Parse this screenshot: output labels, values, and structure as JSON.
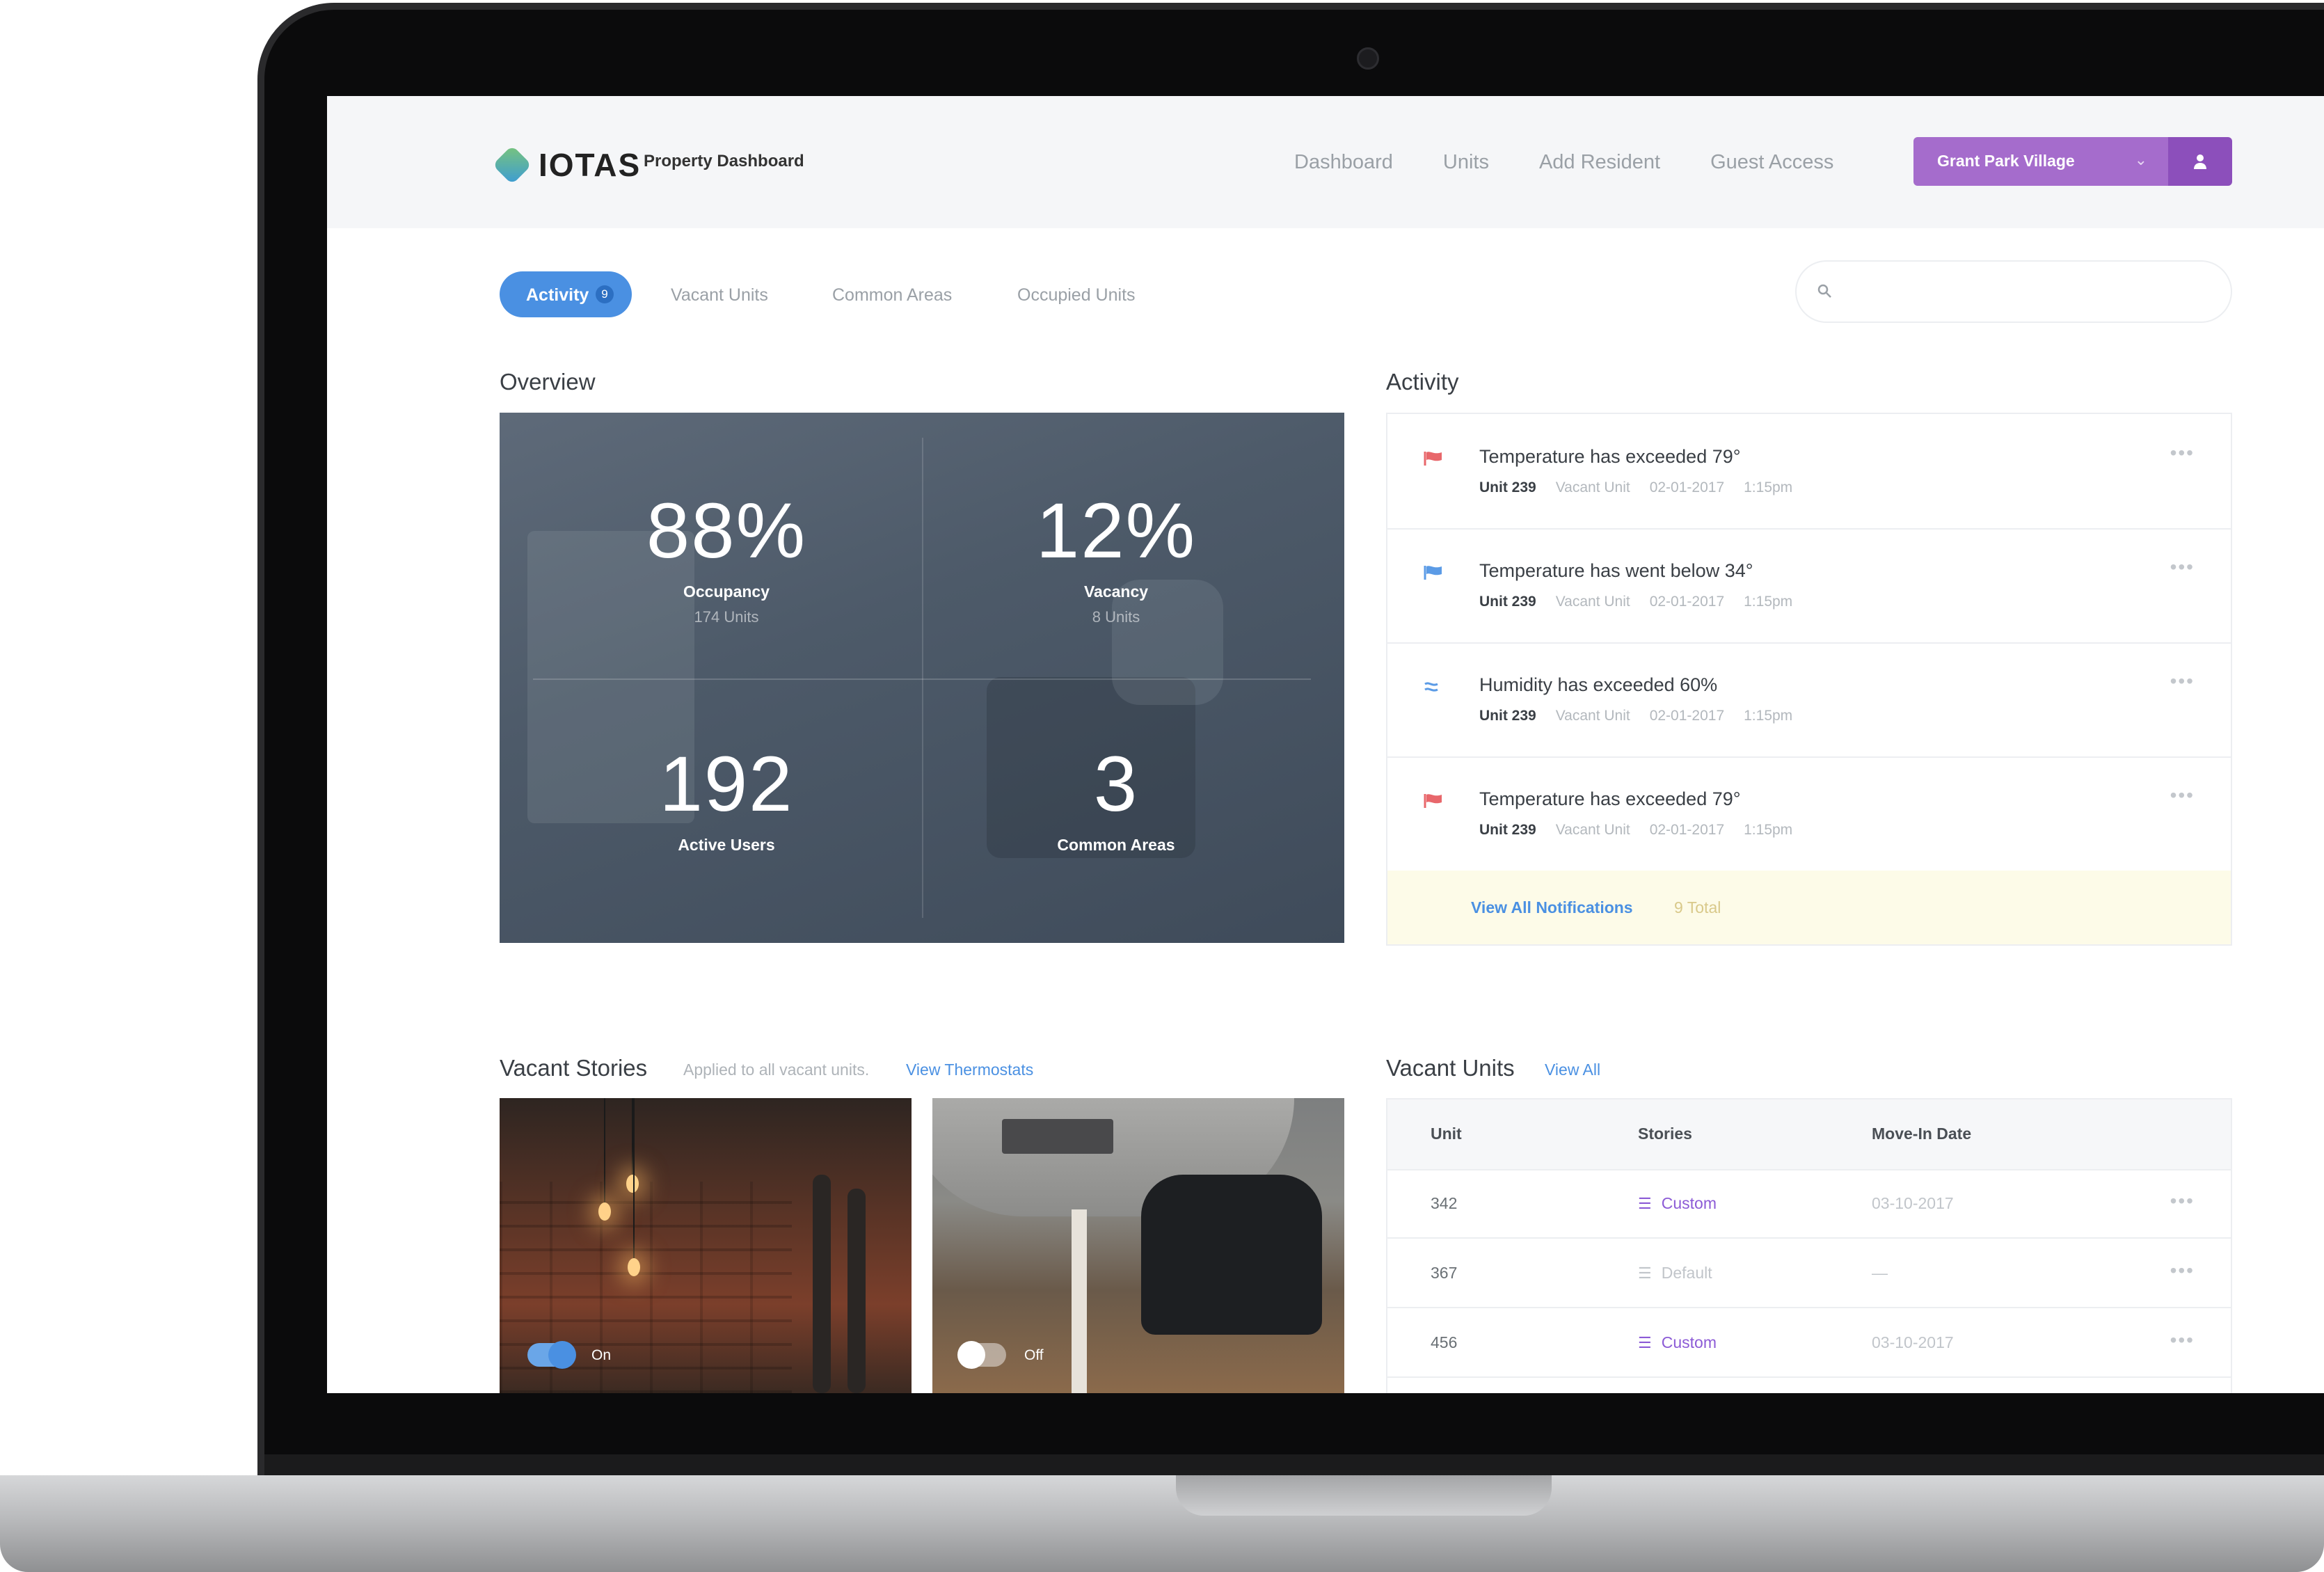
{
  "header": {
    "logo": "IOTAS",
    "app_title": "Property Dashboard",
    "nav": [
      "Dashboard",
      "Units",
      "Add Resident",
      "Guest Access"
    ],
    "property": "Grant Park Village"
  },
  "tabs": {
    "active": {
      "label": "Activity",
      "count": "9"
    },
    "others": [
      "Vacant Units",
      "Common Areas",
      "Occupied Units"
    ]
  },
  "overview": {
    "title": "Overview",
    "stats": [
      {
        "value": "88%",
        "label": "Occupancy",
        "sub": "174 Units"
      },
      {
        "value": "12%",
        "label": "Vacancy",
        "sub": "8 Units"
      },
      {
        "value": "192",
        "label": "Active Users",
        "sub": ""
      },
      {
        "value": "3",
        "label": "Common Areas",
        "sub": ""
      }
    ]
  },
  "activity": {
    "title": "Activity",
    "items": [
      {
        "icon": "flag-red-icon",
        "title": "Temperature has exceeded 79°",
        "unit": "Unit 239",
        "type": "Vacant Unit",
        "date": "02-01-2017",
        "time": "1:15pm",
        "color": "#e8676b"
      },
      {
        "icon": "flag-blue-icon",
        "title": "Temperature has went below 34°",
        "unit": "Unit 239",
        "type": "Vacant Unit",
        "date": "02-01-2017",
        "time": "1:15pm",
        "color": "#5b9be6"
      },
      {
        "icon": "humidity-icon",
        "title": "Humidity has exceeded 60%",
        "unit": "Unit 239",
        "type": "Vacant Unit",
        "date": "02-01-2017",
        "time": "1:15pm",
        "color": "#5b9be6"
      },
      {
        "icon": "flag-red-icon",
        "title": "Temperature has exceeded 79°",
        "unit": "Unit 239",
        "type": "Vacant Unit",
        "date": "02-01-2017",
        "time": "1:15pm",
        "color": "#e8676b"
      }
    ],
    "footer_link": "View All Notifications",
    "footer_count": "9 Total"
  },
  "vacant_stories": {
    "title": "Vacant Stories",
    "note": "Applied to all vacant units.",
    "link": "View Thermostats",
    "cards": [
      {
        "toggle": "On"
      },
      {
        "toggle": "Off"
      }
    ]
  },
  "vacant_units": {
    "title": "Vacant Units",
    "link": "View All",
    "columns": [
      "Unit",
      "Stories",
      "Move-In Date"
    ],
    "rows": [
      {
        "unit": "342",
        "story": "Custom",
        "date": "03-10-2017"
      },
      {
        "unit": "367",
        "story": "Default",
        "date": "—"
      },
      {
        "unit": "456",
        "story": "Custom",
        "date": "03-10-2017"
      }
    ]
  },
  "colors": {
    "accent_blue": "#4a90e2",
    "accent_purple": "#a56ccc",
    "custom_story": "#8c5bd6",
    "alert_red": "#e8676b"
  }
}
